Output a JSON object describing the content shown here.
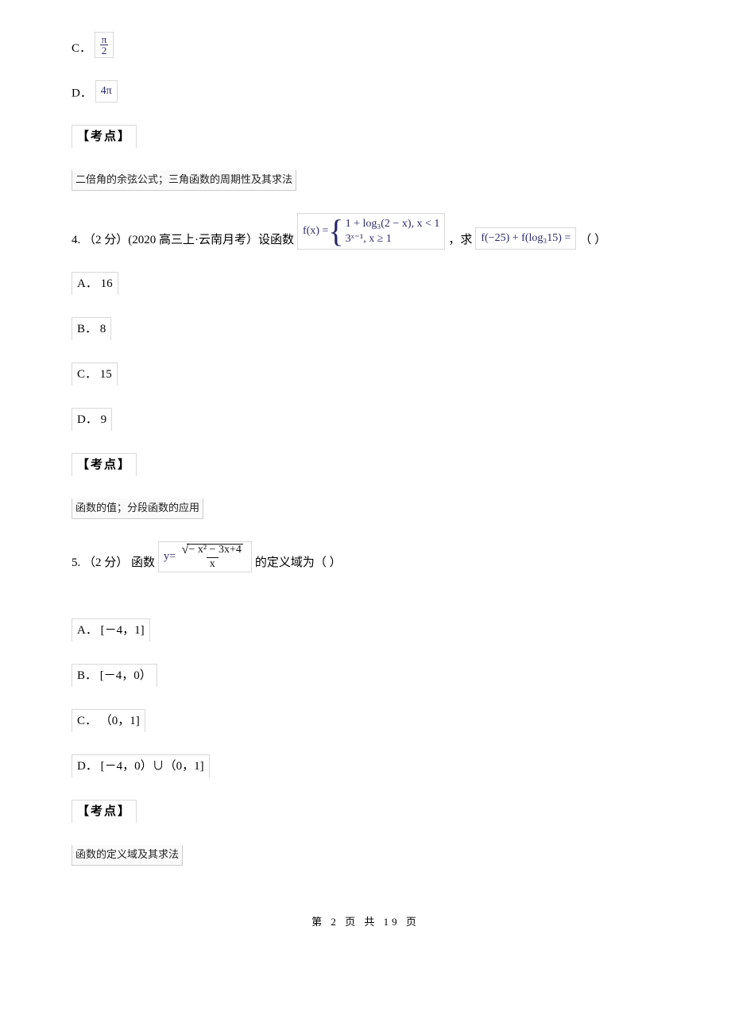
{
  "q3": {
    "optC_label": "C．",
    "optC_frac_num": "π",
    "optC_frac_den": "2",
    "optD_label": "D．",
    "optD_value": "4π",
    "kaodian_label": "【考点】",
    "kaodian_tag": "二倍角的余弦公式；三角函数的周期性及其求法"
  },
  "q4": {
    "prefix": "4. （2 分）(2020 高三上·云南月考）设函数",
    "fx_lhs": "f(x) =",
    "case1": "1 + log₃(2 − x), x < 1",
    "case2": "3ˣ⁻¹, x ≥ 1",
    "mid": "，求",
    "expr": "f(−25) + f(log₃15) =",
    "tail": "（    ）",
    "optA": "A． 16",
    "optB": "B． 8",
    "optC": "C． 15",
    "optD": "D． 9",
    "kaodian_label": "【考点】",
    "kaodian_tag": "函数的值；分段函数的应用"
  },
  "q5": {
    "prefix": "5. （2 分） 函数",
    "y_eq": "y=",
    "radicand": "− x² − 3x+4",
    "denom": "x",
    "suffix": "的定义域为（      ）",
    "optA": "A． [－4，1]",
    "optB": "B． [－4，0）",
    "optC": "C． （0，1]",
    "optD": "D． [－4，0）∪（0，1]",
    "kaodian_label": "【考点】",
    "kaodian_tag": "函数的定义域及其求法"
  },
  "footer": "第 2 页 共 19 页"
}
